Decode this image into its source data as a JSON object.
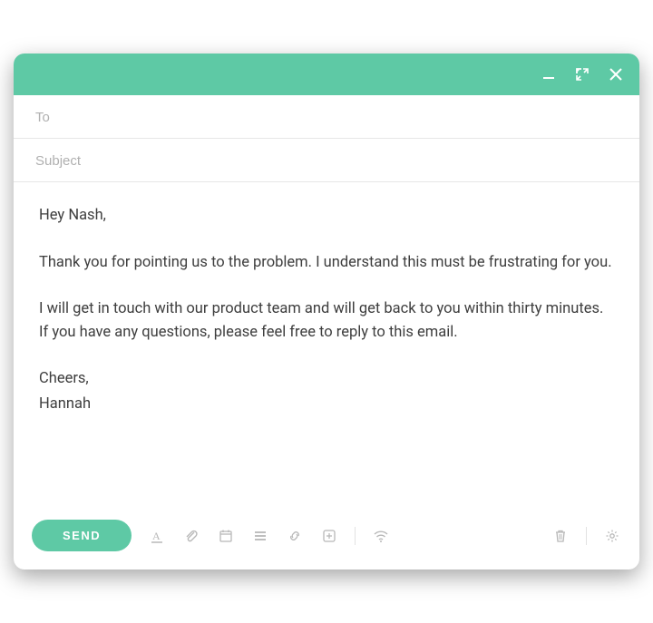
{
  "colors": {
    "accent": "#5ec9a5"
  },
  "fields": {
    "to_placeholder": "To",
    "to_value": "",
    "subject_placeholder": "Subject",
    "subject_value": ""
  },
  "body": {
    "greeting": "Hey Nash,",
    "para1": "Thank you for pointing us to the problem. I understand this must be frustrating for you.",
    "para2": "I will get in touch with our product team and will get back to you within thirty minutes. If you have any questions, please feel free to reply to this email.",
    "signoff": "Cheers,",
    "signature": "Hannah"
  },
  "toolbar": {
    "send_label": "SEND"
  }
}
